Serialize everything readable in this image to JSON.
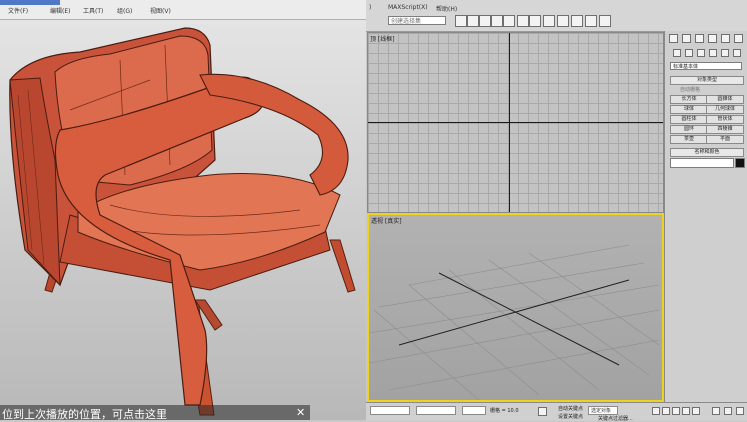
{
  "left": {
    "menu": [
      "文件(F)",
      "编辑(E)",
      "工具(T)",
      "组(G)",
      "视图(V)"
    ]
  },
  "toolbar": {
    "menu": [
      "MAXScript(X)",
      "帮助(H)"
    ],
    "selection_set_placeholder": "创建选择集"
  },
  "viewports": {
    "top_label": "顶 [线框]",
    "perspective_label": "透视 [真实]"
  },
  "command_panel": {
    "dropdown": "标准基本体",
    "object_type": "对象类型",
    "autogrid": "自动栅格",
    "buttons": [
      "长方体",
      "圆锥体",
      "球体",
      "几何球体",
      "圆柱体",
      "管状体",
      "圆环",
      "四棱锥",
      "茶壶",
      "平面"
    ],
    "name_color": "名称和颜色"
  },
  "status": {
    "grid": "栅格 = 10.0",
    "auto_key": "自动关键点",
    "selected": "选定对象",
    "set_key": "设置关键点",
    "filter": "关键点过滤器..."
  },
  "toast": {
    "text": "位到上次播放的位置，可点击这里",
    "close": "✕"
  },
  "colors": {
    "active_viewport_border": "#f0d21d",
    "chair": "#d0573a"
  }
}
